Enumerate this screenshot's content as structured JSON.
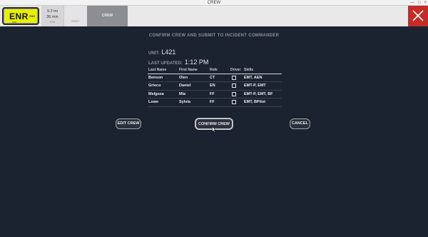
{
  "window": {
    "title": "CREW",
    "controls": {
      "minimize": "—",
      "maximize": "□",
      "close": "×"
    }
  },
  "topbar": {
    "status": {
      "code": "ENR",
      "sub": "ENR",
      "tag": "ENG"
    },
    "metrics": {
      "distance": "9.2 mi",
      "time": "36 min",
      "eta_label": "ETA"
    },
    "reset_label": "RESET",
    "active_tab": "CREW",
    "close_icon": "close-icon"
  },
  "content": {
    "heading": "CONFIRM CREW AND SUBMIT TO INCIDENT COMMANDER",
    "unit_label": "UNIT:",
    "unit_value": "L421",
    "updated_label": "LAST UPDATED:",
    "updated_value": "1:12 PM",
    "columns": [
      "Last Name",
      "First Name",
      "Role",
      "Driver",
      "Skills"
    ],
    "rows": [
      {
        "last": "Benson",
        "first": "Olen",
        "role": "CT",
        "driver": false,
        "skills": "EMT, AEN"
      },
      {
        "last": "Grieco",
        "first": "Daniel",
        "role": "EN",
        "driver": false,
        "skills": "EMT-P, EMT"
      },
      {
        "last": "Melgoza",
        "first": "Mia",
        "role": "FF",
        "driver": false,
        "skills": "EMT-P, EMT, BF"
      },
      {
        "last": "Lowe",
        "first": "Sylvia",
        "role": "FF",
        "driver": false,
        "skills": "EMT, BPilot"
      }
    ],
    "buttons": {
      "edit": "EDIT CREW",
      "confirm": "CONFIRM CREW",
      "cancel": "CANCEL"
    }
  },
  "colors": {
    "background": "#1b2330",
    "status_yellow": "#e8f000",
    "close_red": "#c62b26",
    "active_tab": "#8c8e91"
  }
}
